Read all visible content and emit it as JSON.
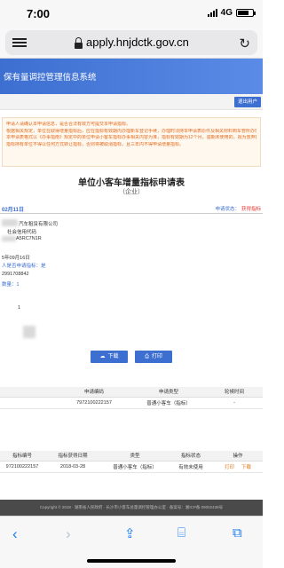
{
  "status_bar": {
    "time": "7:00",
    "network": "4G"
  },
  "browser": {
    "url": "apply.hnjdctk.gov.cn"
  },
  "site": {
    "title": "保有量调控管理信息系统",
    "logout": "退出用户"
  },
  "notice": {
    "lines": [
      "申请人请确认本申请信息，是否合法有效方可提交本申请指标。",
      "根据相关规定，单位在取得增量指标后，应在指标有效期内办理新车登记手续，办理时须持本申请表原件及相关材料到车管所办理，如办理完毕请及时注销。",
      "本申请表格式以《办事指南》规定中的单位申请小客车指标办事相关内容为准，指标有效期为12个月，逾期未使用的，视为放弃指标。",
      "指标持有单位不得以任何方式转让指标，否则将被取消指标，且三年内不得申请增量指标。"
    ]
  },
  "form": {
    "title": "单位小客车增量指标申请表",
    "subtitle": "（企业）",
    "date": "02月11日",
    "status_label": "申请状态：",
    "status_value": "获得指标",
    "fields": [
      "汽车租赁有限公司",
      "社会信用代码",
      "A5RC7N1R",
      "5年09月16日",
      "人是否申请指标：是",
      "2991708842",
      "数量：1",
      "1"
    ]
  },
  "buttons": {
    "download": "下载",
    "print": "打印"
  },
  "apply_table": {
    "headers": [
      "申请编码",
      "申请类型",
      "轮候时间"
    ],
    "rows": [
      {
        "code": "7972100222157",
        "type": "普通小客车（指标）",
        "wait": "-"
      }
    ]
  },
  "quota_table": {
    "headers": [
      "指标编号",
      "指标获得日期",
      "类型",
      "指标状态",
      "操作"
    ],
    "rows": [
      {
        "code": "972100222157",
        "date": "2018-03-28",
        "type": "普通小客车（指标）",
        "status": "有效未使用",
        "print": "打印",
        "download": "下载"
      }
    ]
  },
  "footer": {
    "text": "Copyright © 2018 · 湖南省人民政府 · 长沙市小客车总量调控管理办公室 · 备案号：湘ICP备 09002438号"
  },
  "icons": {
    "menu": "menu-icon",
    "lock": "lock-icon",
    "reload": "reload-icon",
    "back": "back-icon",
    "forward": "forward-icon",
    "share": "share-icon",
    "bookmarks": "bookmarks-icon",
    "tabs": "tabs-icon"
  },
  "colors": {
    "brand": "#3d6fd1",
    "notice_text": "#e06a1b",
    "status_red": "#e53935",
    "action_orange": "#e07a1b"
  }
}
